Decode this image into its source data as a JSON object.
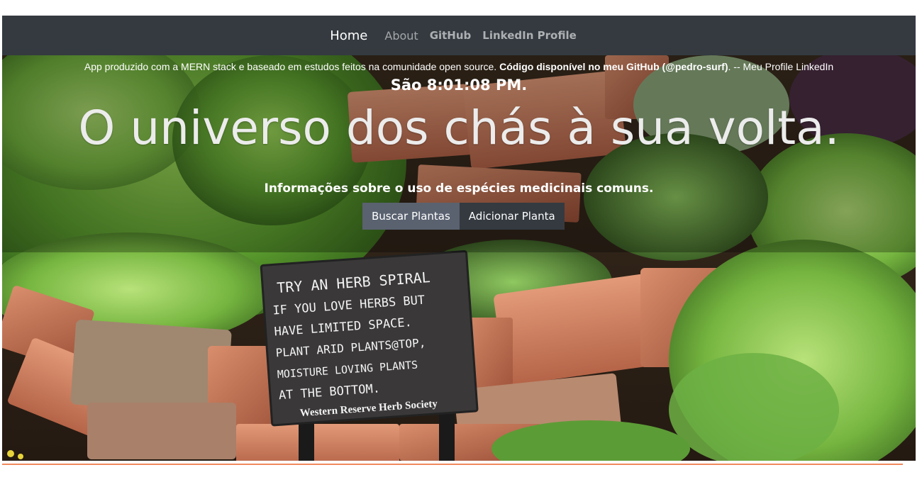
{
  "navbar": {
    "home": "Home",
    "about": "About",
    "github": "GitHub",
    "linkedin": "LinkedIn Profile"
  },
  "hero": {
    "credits_prefix": "App produzido com a MERN stack e baseado em estudos feitos na comunidade open source.",
    "credits_bold": "Código disponível no meu GitHub (@pedro-surf)",
    "credits_suffix": ". -- Meu Profile LinkedIn",
    "clock": "São 8:01:08 PM.",
    "headline": "O universo dos chás à sua volta.",
    "subtitle": "Informações sobre o uso de espécies medicinais comuns.",
    "buttons": {
      "search": "Buscar Plantas",
      "add": "Adicionar Planta"
    }
  },
  "photo_sign": {
    "line1": "TRY AN HERB SPIRAL",
    "line2": "IF YOU LOVE HERBS BUT",
    "line3": "HAVE LIMITED SPACE.",
    "line4": "PLANT ARID PLANTS@TOP,",
    "line5": "MOISTURE LOVING PLANTS",
    "line6": "AT THE BOTTOM.",
    "line7": "Western Reserve Herb Society"
  },
  "colors": {
    "navbar": "#343a40",
    "button_primary": "#5a6270",
    "button_dark": "#343a40",
    "accent_line": "#f08a5d"
  }
}
